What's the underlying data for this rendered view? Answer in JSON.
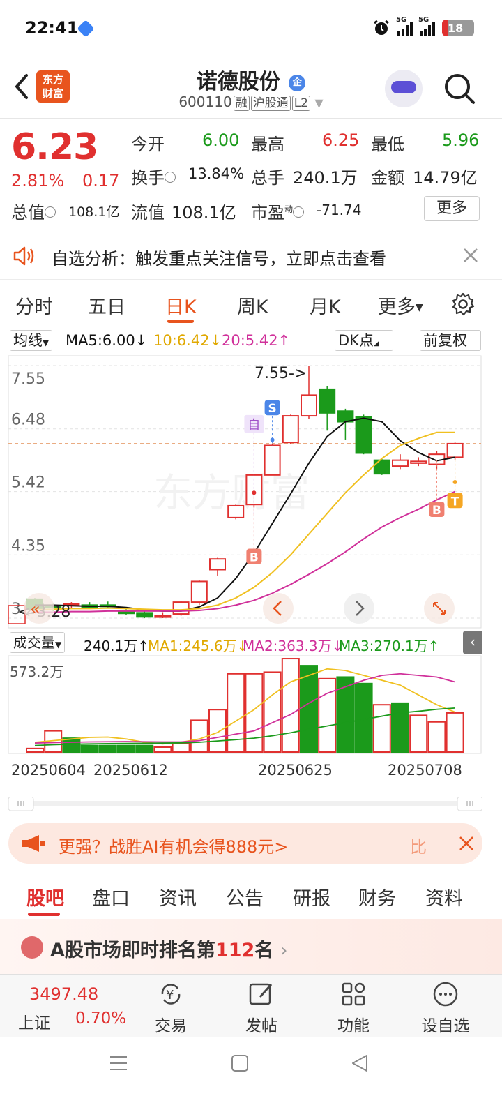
{
  "status": {
    "time": "22:41",
    "signal1": "5G",
    "signal2": "5G",
    "battery": "18"
  },
  "header": {
    "logo_line1": "东方",
    "logo_line2": "财富",
    "name": "诺德股份",
    "badge": "企",
    "code": "600110",
    "tags": [
      "融",
      "沪股通",
      "L2"
    ]
  },
  "quote": {
    "price": "6.23",
    "pct": "2.81%",
    "change": "0.17",
    "open_label": "今开",
    "open": "6.00",
    "high_label": "最高",
    "high": "6.25",
    "low_label": "最低",
    "low": "5.96",
    "turnover_label": "换手",
    "turnover": "13.84%",
    "volume_label": "总手",
    "volume": "240.1万",
    "amount_label": "金额",
    "amount": "14.79亿",
    "mcap_label": "总值",
    "mcap": "108.1亿",
    "float_label": "流值",
    "float": "108.1亿",
    "pe_label": "市盈",
    "pe_sup": "动",
    "pe": "-71.74",
    "more": "更多"
  },
  "alert": {
    "text": "自选分析：触发重点关注信号，立即点击查看"
  },
  "period_tabs": [
    "分时",
    "五日",
    "日K",
    "周K",
    "月K",
    "更多"
  ],
  "active_period": 2,
  "ma_bar": {
    "selector": "均线",
    "ma5": "MA5:6.00↓",
    "ma10": "10:6.42↓",
    "ma20": "20:5.42↑",
    "dk": "DK点",
    "adjust": "前复权"
  },
  "colors": {
    "up": "#e0302f",
    "down": "#1b9a1b",
    "ma5": "#111111",
    "ma10": "#f0c020",
    "ma20": "#d0309a",
    "brand": "#e8541e"
  },
  "chart_data": [
    {
      "type": "candlestick",
      "y_ticks": [
        "7.55",
        "6.48",
        "5.42",
        "4.35",
        "3.28"
      ],
      "ylim": [
        3.28,
        7.55
      ],
      "annotations": {
        "high_marker": "7.55->",
        "low_marker": "<-3.28",
        "signal_S": "S",
        "signal_self": "自",
        "signal_B": "B",
        "signal_T": "T"
      },
      "candles": [
        {
          "o": 3.6,
          "c": 3.43,
          "h": 3.62,
          "l": 3.4
        },
        {
          "o": 3.48,
          "c": 3.46,
          "h": 3.52,
          "l": 3.4
        },
        {
          "o": 3.5,
          "c": 3.52,
          "h": 3.55,
          "l": 3.45
        },
        {
          "o": 3.5,
          "c": 3.46,
          "h": 3.55,
          "l": 3.44
        },
        {
          "o": 3.5,
          "c": 3.48,
          "h": 3.56,
          "l": 3.45
        },
        {
          "o": 3.4,
          "c": 3.36,
          "h": 3.43,
          "l": 3.33
        },
        {
          "o": 3.37,
          "c": 3.3,
          "h": 3.4,
          "l": 3.28
        },
        {
          "o": 3.3,
          "c": 3.32,
          "h": 3.38,
          "l": 3.28
        },
        {
          "o": 3.35,
          "c": 3.55,
          "h": 3.57,
          "l": 3.32
        },
        {
          "o": 3.55,
          "c": 3.9,
          "h": 3.92,
          "l": 3.5
        },
        {
          "o": 4.1,
          "c": 4.28,
          "h": 4.3,
          "l": 4.0
        },
        {
          "o": 4.98,
          "c": 5.18,
          "h": 5.2,
          "l": 4.95
        },
        {
          "o": 5.2,
          "c": 5.7,
          "h": 5.72,
          "l": 5.15
        },
        {
          "o": 5.7,
          "c": 6.2,
          "h": 6.22,
          "l": 5.7
        },
        {
          "o": 6.25,
          "c": 6.7,
          "h": 6.72,
          "l": 6.22
        },
        {
          "o": 6.7,
          "c": 7.05,
          "h": 7.55,
          "l": 6.65
        },
        {
          "o": 7.15,
          "c": 6.75,
          "h": 7.2,
          "l": 6.45
        },
        {
          "o": 6.78,
          "c": 6.6,
          "h": 6.82,
          "l": 6.3
        },
        {
          "o": 6.68,
          "c": 6.07,
          "h": 6.72,
          "l": 6.05
        },
        {
          "o": 5.95,
          "c": 5.72,
          "h": 5.97,
          "l": 5.7
        },
        {
          "o": 5.85,
          "c": 5.95,
          "h": 6.05,
          "l": 5.8
        },
        {
          "o": 5.9,
          "c": 5.93,
          "h": 6.0,
          "l": 5.85
        },
        {
          "o": 5.88,
          "c": 6.05,
          "h": 6.1,
          "l": 5.8
        },
        {
          "o": 6.0,
          "c": 6.23,
          "h": 6.25,
          "l": 5.96
        }
      ],
      "ma5": [
        3.5,
        3.5,
        3.49,
        3.48,
        3.48,
        3.46,
        3.42,
        3.4,
        3.4,
        3.47,
        3.62,
        3.95,
        4.38,
        4.88,
        5.38,
        5.9,
        6.35,
        6.6,
        6.66,
        6.6,
        6.28,
        6.08,
        5.94,
        6.0
      ],
      "ma10": [
        3.42,
        3.43,
        3.44,
        3.44,
        3.45,
        3.44,
        3.43,
        3.42,
        3.42,
        3.44,
        3.5,
        3.62,
        3.8,
        4.05,
        4.35,
        4.7,
        5.05,
        5.4,
        5.7,
        5.98,
        6.2,
        6.32,
        6.42,
        6.42
      ],
      "ma20": [
        3.38,
        3.38,
        3.39,
        3.39,
        3.4,
        3.4,
        3.4,
        3.4,
        3.4,
        3.41,
        3.44,
        3.5,
        3.58,
        3.7,
        3.85,
        4.02,
        4.2,
        4.4,
        4.62,
        4.82,
        4.98,
        5.12,
        5.28,
        5.42
      ]
    },
    {
      "type": "bar",
      "series_label": "成交量",
      "current": "240.1万↑",
      "ma1": "MA1:245.6万↓",
      "ma2": "MA2:363.3万↓",
      "ma3": "MA3:270.1万↑",
      "y_max_label": "573.2万",
      "ylim": [
        0,
        573.2
      ],
      "values": [
        22,
        130,
        85,
        40,
        40,
        40,
        40,
        30,
        55,
        195,
        260,
        480,
        480,
        490,
        573,
        530,
        450,
        460,
        420,
        290,
        300,
        225,
        185,
        240
      ],
      "up": [
        true,
        true,
        false,
        false,
        false,
        false,
        false,
        true,
        true,
        true,
        true,
        true,
        true,
        true,
        true,
        false,
        true,
        false,
        false,
        true,
        false,
        true,
        true,
        true
      ],
      "ma1_values": [
        60,
        70,
        80,
        90,
        92,
        80,
        60,
        50,
        60,
        80,
        120,
        190,
        260,
        350,
        430,
        470,
        510,
        500,
        470,
        440,
        410,
        350,
        290,
        245
      ],
      "ma2_values": [
        55,
        58,
        60,
        62,
        63,
        64,
        63,
        62,
        62,
        70,
        90,
        110,
        130,
        180,
        230,
        300,
        360,
        400,
        440,
        470,
        480,
        470,
        460,
        430
      ],
      "ma3_values": [
        40,
        45,
        48,
        50,
        52,
        53,
        54,
        55,
        56,
        60,
        68,
        76,
        85,
        100,
        118,
        140,
        160,
        180,
        200,
        220,
        240,
        250,
        262,
        270
      ],
      "dates": [
        "20250604",
        "20250612",
        "20250625",
        "20250708"
      ]
    }
  ],
  "promo": {
    "text": "更强？战胜AI有机会得888元>",
    "side": "比"
  },
  "info_tabs": [
    "股吧",
    "盘口",
    "资讯",
    "公告",
    "研报",
    "财务",
    "资料"
  ],
  "rank": {
    "prefix": "A股市场即时排名第",
    "num": "112",
    "suffix": "名"
  },
  "bottom_nav": {
    "index_value": "3497.48",
    "index_name": "上证",
    "index_pct": "0.70%",
    "items": [
      "交易",
      "发帖",
      "功能",
      "设自选"
    ]
  }
}
